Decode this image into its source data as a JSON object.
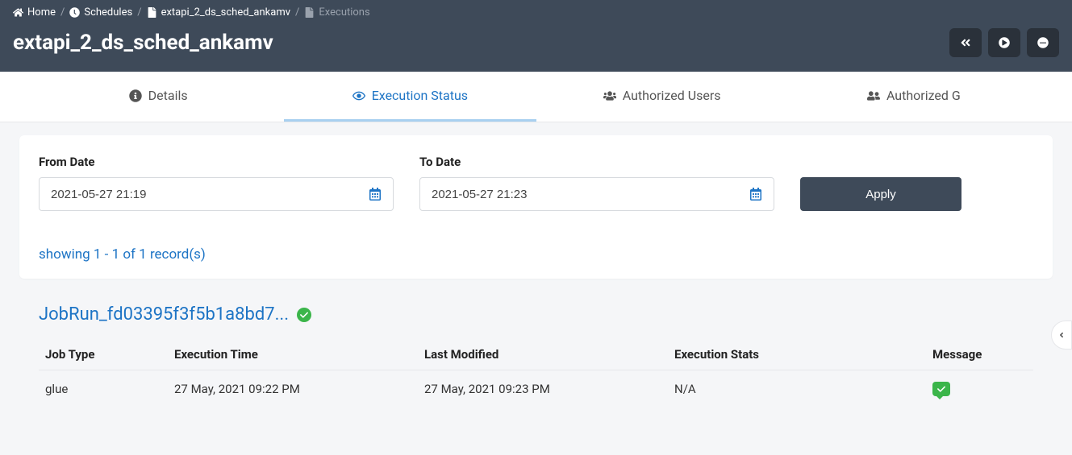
{
  "breadcrumb": {
    "home": "Home",
    "schedules": "Schedules",
    "current": "extapi_2_ds_sched_ankamv",
    "executions": "Executions"
  },
  "page_title": "extapi_2_ds_sched_ankamv",
  "tabs": {
    "details": "Details",
    "execution_status": "Execution Status",
    "authorized_users": "Authorized Users",
    "authorized_groups": "Authorized G"
  },
  "filters": {
    "from_label": "From Date",
    "from_value": "2021-05-27 21:19",
    "to_label": "To Date",
    "to_value": "2021-05-27 21:23",
    "apply": "Apply"
  },
  "records_text": "showing 1 - 1 of 1 record(s)",
  "job": {
    "title": "JobRun_fd03395f3f5b1a8bd7...",
    "columns": {
      "job_type": "Job Type",
      "execution_time": "Execution Time",
      "last_modified": "Last Modified",
      "execution_stats": "Execution Stats",
      "message": "Message"
    },
    "row": {
      "job_type": "glue",
      "execution_time": "27 May, 2021 09:22 PM",
      "last_modified": "27 May, 2021 09:23 PM",
      "execution_stats": "N/A"
    }
  }
}
